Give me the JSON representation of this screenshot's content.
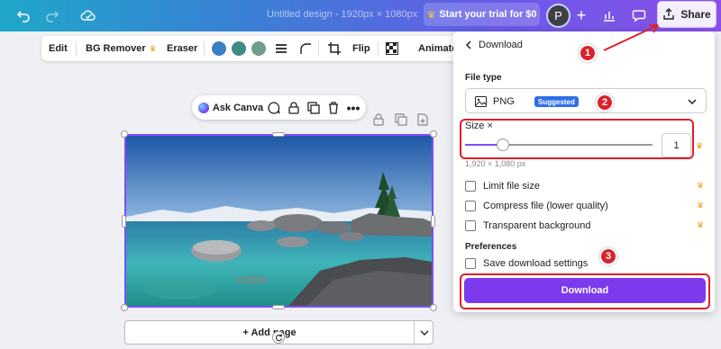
{
  "topbar": {
    "title": "Untitled design - 1920px × 1080px",
    "trial_label": "Start your trial for $0",
    "avatar_letter": "P",
    "share_label": "Share"
  },
  "toolbar": {
    "edit": "Edit",
    "bg_remover": "BG Remover",
    "eraser": "Eraser",
    "flip": "Flip",
    "animate": "Animate",
    "swatches": [
      "#3b7fc4",
      "#3f8a84",
      "#6f9e8a"
    ]
  },
  "float_bar": {
    "ask_canva": "Ask Canva"
  },
  "add_page": {
    "label": "+ Add page"
  },
  "panel": {
    "back_title": "Download",
    "file_type_label": "File type",
    "file_type_value": "PNG",
    "file_type_badge": "Suggested",
    "size_label": "Size ×",
    "size_value": "1",
    "size_fraction": 0.2,
    "dimensions": "1,920 × 1,080 px",
    "options": [
      "Limit file size",
      "Compress file (lower quality)",
      "Transparent background"
    ],
    "preferences_label": "Preferences",
    "save_settings": "Save download settings",
    "download_button": "Download"
  },
  "annotations": [
    "1",
    "2",
    "3"
  ],
  "colors": {
    "accent": "#7c3aed",
    "annotation_red": "#e01f26"
  }
}
